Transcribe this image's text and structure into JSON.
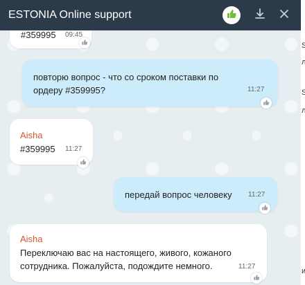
{
  "header": {
    "title": "ESTONIA Online support",
    "like_icon": "thumbs-up-icon",
    "download_icon": "download-icon",
    "close_icon": "close-icon",
    "accent_color": "#6fbf3a",
    "background_color": "#2c3b4a"
  },
  "messages": [
    {
      "from": "operator",
      "text": "#359995",
      "time": "09:45"
    },
    {
      "from": "user",
      "text": "повторю вопрос - что со сроком поставки по ордеру #359995?",
      "time": "11:27"
    },
    {
      "from": "operator",
      "sender": "Aisha",
      "text": "#359995",
      "time": "11:27"
    },
    {
      "from": "user",
      "text": "передай вопрос человеку",
      "time": "11:27"
    },
    {
      "from": "operator",
      "sender": "Aisha",
      "text": "Переключаю вас на настоящего, живого, кожаного сотрудника. Пожалуйста, подождите немного.",
      "time": "11:27"
    }
  ],
  "edge_chars": [
    "S",
    "л",
    "S",
    "л",
    "и"
  ],
  "colors": {
    "operator_bubble": "#ffffff",
    "user_bubble": "#cdecfb",
    "sender_name": "#d35a2a",
    "chat_background": "#e7eef1"
  }
}
